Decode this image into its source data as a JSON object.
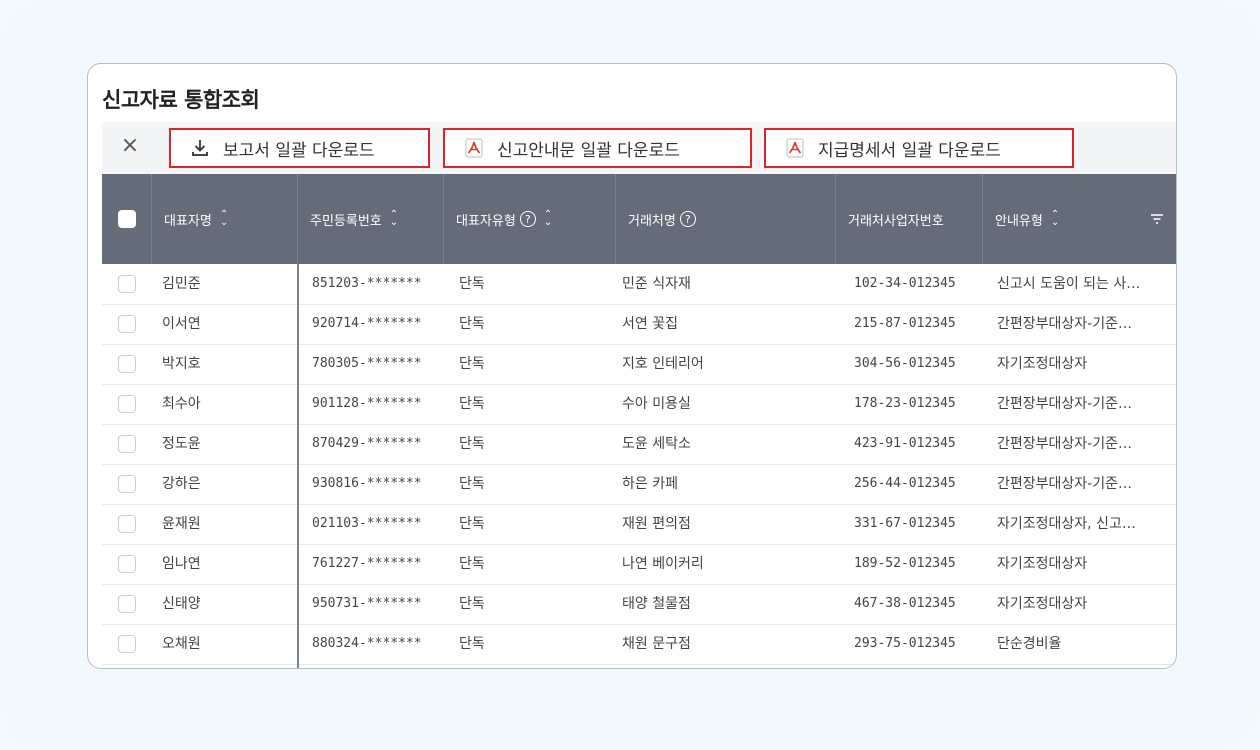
{
  "page": {
    "title": "신고자료 통합조회"
  },
  "toolbar": {
    "close_label": "×",
    "buttons": [
      {
        "label": "보고서 일괄 다운로드",
        "icon": "download-icon"
      },
      {
        "label": "신고안내문 일괄 다운로드",
        "icon": "pdf-icon"
      },
      {
        "label": "지급명세서 일괄 다운로드",
        "icon": "pdf-icon"
      }
    ]
  },
  "table": {
    "columns": [
      {
        "label": "대표자명",
        "sortable": true,
        "help": false
      },
      {
        "label": "주민등록번호",
        "sortable": true,
        "help": false
      },
      {
        "label": "대표자유형",
        "sortable": true,
        "help": true
      },
      {
        "label": "거래처명",
        "sortable": false,
        "help": true
      },
      {
        "label": "거래처사업자번호",
        "sortable": false,
        "help": false
      },
      {
        "label": "안내유형",
        "sortable": true,
        "help": false,
        "filter": true
      }
    ],
    "rows": [
      {
        "name": "김민준",
        "rrn": "851203-*******",
        "type": "단독",
        "client": "민준 식자재",
        "biz": "102-34-012345",
        "guide": "신고시 도움이 되는 사…"
      },
      {
        "name": "이서연",
        "rrn": "920714-*******",
        "type": "단독",
        "client": "서연 꽃집",
        "biz": "215-87-012345",
        "guide": "간편장부대상자-기준…"
      },
      {
        "name": "박지호",
        "rrn": "780305-*******",
        "type": "단독",
        "client": "지호 인테리어",
        "biz": "304-56-012345",
        "guide": "자기조정대상자"
      },
      {
        "name": "최수아",
        "rrn": "901128-*******",
        "type": "단독",
        "client": "수아 미용실",
        "biz": "178-23-012345",
        "guide": "간편장부대상자-기준…"
      },
      {
        "name": "정도윤",
        "rrn": "870429-*******",
        "type": "단독",
        "client": "도윤 세탁소",
        "biz": "423-91-012345",
        "guide": "간편장부대상자-기준…"
      },
      {
        "name": "강하은",
        "rrn": "930816-*******",
        "type": "단독",
        "client": "하은 카페",
        "biz": "256-44-012345",
        "guide": "간편장부대상자-기준…"
      },
      {
        "name": "윤재원",
        "rrn": "021103-*******",
        "type": "단독",
        "client": "재원 편의점",
        "biz": "331-67-012345",
        "guide": "자기조정대상자, 신고…"
      },
      {
        "name": "임나연",
        "rrn": "761227-*******",
        "type": "단독",
        "client": "나연 베이커리",
        "biz": "189-52-012345",
        "guide": "자기조정대상자"
      },
      {
        "name": "신태양",
        "rrn": "950731-*******",
        "type": "단독",
        "client": "태양 철물점",
        "biz": "467-38-012345",
        "guide": "자기조정대상자"
      },
      {
        "name": "오채원",
        "rrn": "880324-*******",
        "type": "단독",
        "client": "채원 문구점",
        "biz": "293-75-012345",
        "guide": "단순경비율"
      }
    ]
  },
  "colors": {
    "header_bg": "#636c78",
    "highlight_border": "#d6262b",
    "pdf_red": "#d9382f"
  }
}
